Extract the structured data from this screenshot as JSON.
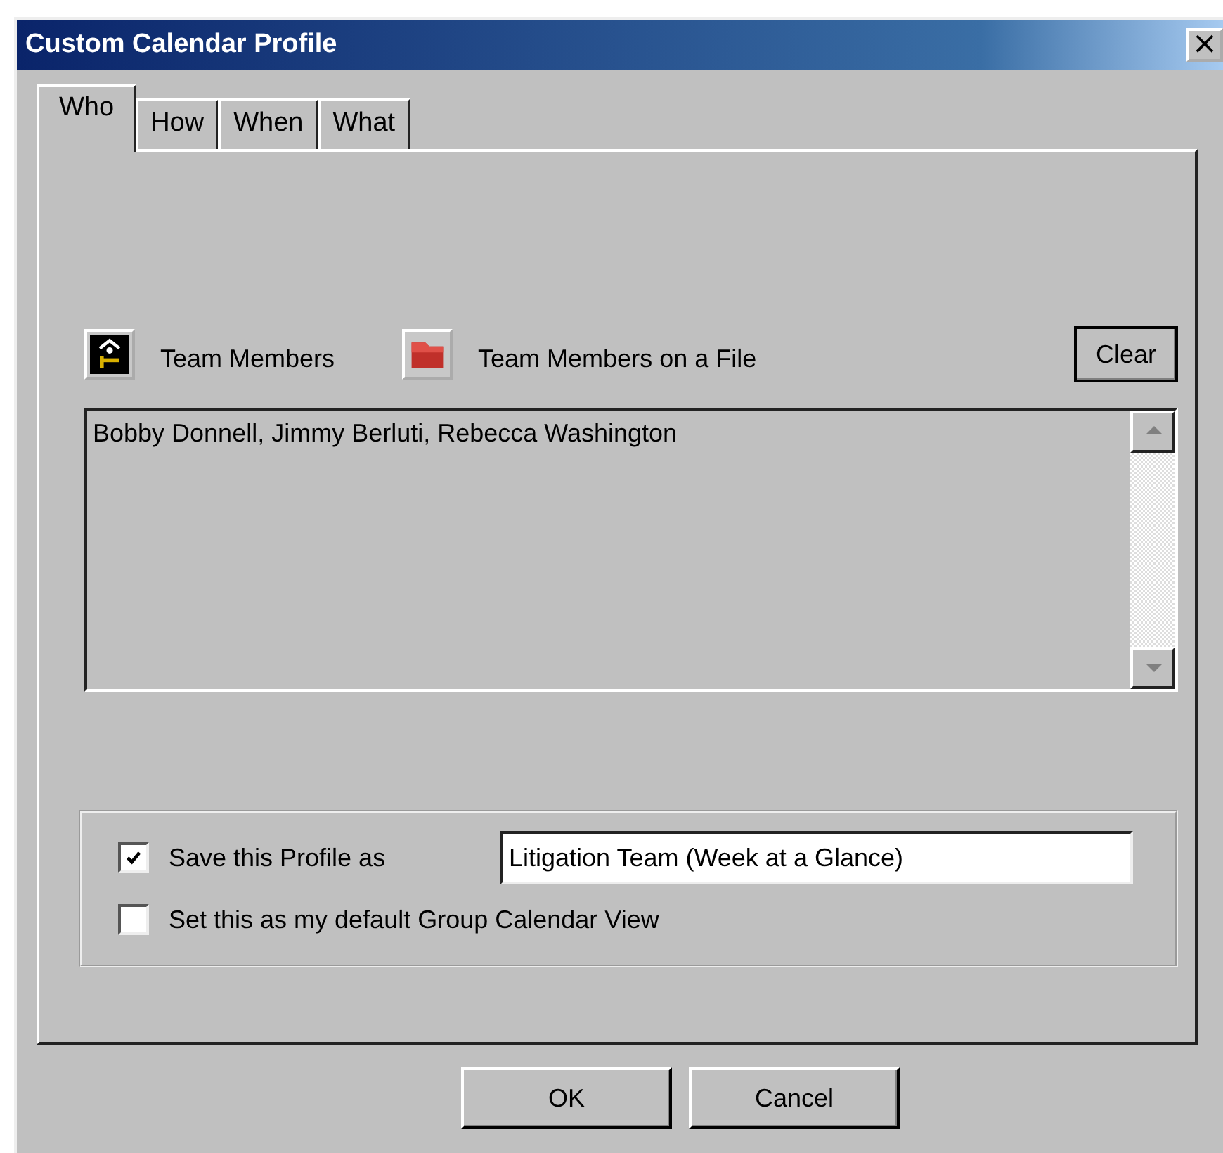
{
  "window": {
    "title": "Custom Calendar Profile",
    "close": "×"
  },
  "tabs": [
    {
      "label": "Who",
      "selected": true
    },
    {
      "label": "How",
      "selected": false
    },
    {
      "label": "When",
      "selected": false
    },
    {
      "label": "What",
      "selected": false
    }
  ],
  "pickers": [
    {
      "kind": "team",
      "label": "Team Members"
    },
    {
      "kind": "file",
      "label": "Team Members on a File"
    }
  ],
  "clear_button": "Clear",
  "members_text": "Bobby Donnell, Jimmy Berluti, Rebecca Washington",
  "options": [
    {
      "kind": "save",
      "label": "Save this Profile as",
      "checked": true,
      "value": "Litigation Team (Week at a Glance)"
    },
    {
      "kind": "default",
      "label": "Set this as my default Group Calendar View",
      "checked": false
    }
  ],
  "buttons": [
    "OK",
    "Cancel"
  ]
}
